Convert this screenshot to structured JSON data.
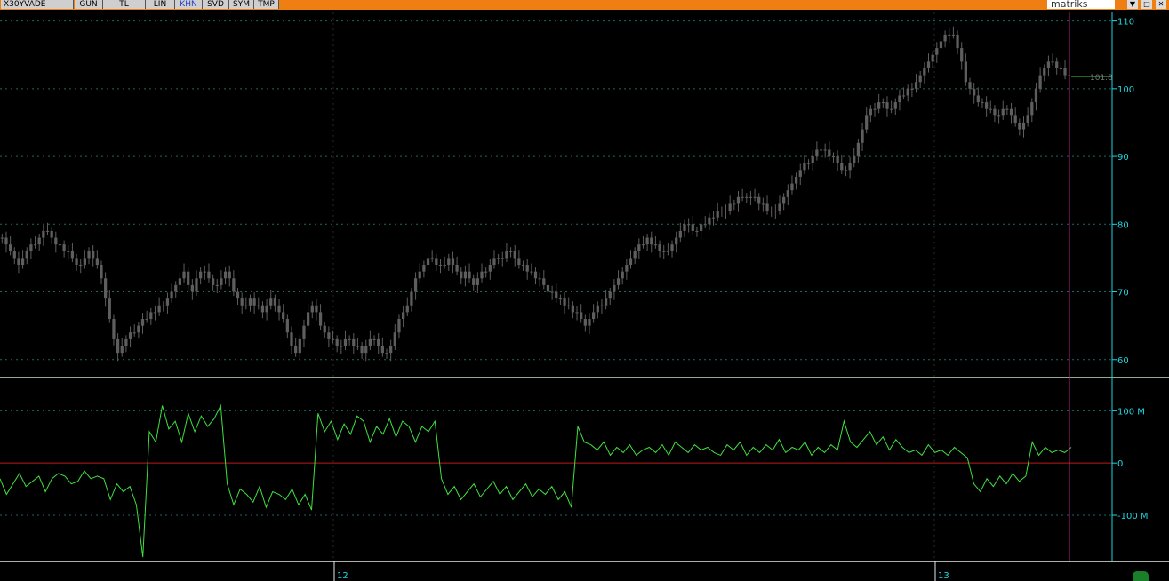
{
  "toolbar": {
    "symbol": "X30YVADE",
    "tabs": [
      {
        "label": "GUN",
        "active": false
      },
      {
        "label": "TL",
        "active": false
      },
      {
        "label": "LIN",
        "active": false
      },
      {
        "label": "KHN",
        "active": true
      },
      {
        "label": "SVD",
        "active": false
      },
      {
        "label": "SYM",
        "active": false
      },
      {
        "label": "TMP",
        "active": false
      }
    ],
    "brand": "matriks",
    "controls": [
      "▼",
      "□",
      "✕"
    ]
  },
  "colors": {
    "background": "#000000",
    "accent_bar": "#f07f13",
    "axis_text": "#1fd6e0",
    "candle": "#5e5e5e",
    "indicator_line": "#3fe13f",
    "zero_line": "#c01818",
    "cursor_line": "#b0208e",
    "last_price_line": "#2fa82f"
  },
  "chart_data": [
    {
      "type": "candlestick",
      "title": "",
      "last_price_label": "101.8",
      "y_ticks": [
        "110",
        "100",
        "90",
        "80",
        "70",
        "60"
      ],
      "ylim": [
        58,
        111
      ],
      "grid": true,
      "close_series": [
        78,
        77,
        76,
        75,
        74,
        75,
        76,
        77,
        77,
        78,
        79,
        79,
        78,
        77,
        77,
        76,
        76,
        75,
        74,
        74,
        75,
        76,
        75,
        74,
        72,
        69,
        66,
        63,
        61,
        62,
        63,
        64,
        64,
        65,
        66,
        66,
        67,
        67,
        68,
        68,
        69,
        70,
        71,
        72,
        73,
        71,
        70,
        72,
        73,
        73,
        72,
        71,
        71,
        72,
        73,
        72,
        70,
        69,
        68,
        68,
        69,
        68,
        68,
        67,
        68,
        69,
        68,
        67,
        66,
        64,
        62,
        61,
        63,
        65,
        67,
        68,
        67,
        65,
        64,
        63,
        63,
        62,
        62,
        63,
        63,
        62,
        62,
        61,
        62,
        63,
        63,
        62,
        61,
        61,
        62,
        64,
        66,
        67,
        68,
        70,
        72,
        73,
        74,
        75,
        75,
        74,
        74,
        74,
        75,
        74,
        73,
        72,
        73,
        72,
        71,
        72,
        73,
        73,
        74,
        75,
        75,
        75,
        76,
        76,
        75,
        74,
        74,
        73,
        73,
        72,
        72,
        71,
        70,
        70,
        69,
        69,
        68,
        68,
        67,
        67,
        66,
        65,
        66,
        67,
        68,
        68,
        69,
        70,
        71,
        72,
        73,
        74,
        75,
        76,
        77,
        77,
        78,
        77,
        77,
        76,
        76,
        76,
        77,
        78,
        79,
        80,
        80,
        79,
        79,
        80,
        80,
        81,
        81,
        82,
        82,
        82,
        83,
        83,
        84,
        84,
        84,
        84,
        84,
        83,
        83,
        82,
        82,
        82,
        83,
        84,
        85,
        86,
        87,
        88,
        89,
        89,
        90,
        91,
        91,
        91,
        90,
        90,
        89,
        88,
        88,
        89,
        90,
        92,
        94,
        96,
        97,
        97,
        98,
        98,
        97,
        97,
        98,
        99,
        99,
        100,
        100,
        101,
        102,
        103,
        104,
        105,
        106,
        107,
        108,
        108,
        108,
        106,
        104,
        101,
        100,
        99,
        98,
        98,
        97,
        97,
        96,
        96,
        97,
        97,
        96,
        95,
        94,
        95,
        96,
        98,
        100,
        102,
        103,
        104,
        104,
        103,
        103,
        102,
        102
      ]
    },
    {
      "type": "line",
      "title": "",
      "y_ticks": [
        "100 M",
        "0",
        "-100 M"
      ],
      "ylim": [
        -185,
        155
      ],
      "zero_line": true,
      "values": [
        -30,
        -60,
        -40,
        -20,
        -45,
        -35,
        -25,
        -55,
        -30,
        -20,
        -25,
        -40,
        -35,
        -15,
        -30,
        -25,
        -30,
        -70,
        -40,
        -55,
        -45,
        -80,
        -180,
        60,
        40,
        110,
        65,
        80,
        40,
        95,
        60,
        90,
        70,
        85,
        110,
        -40,
        -80,
        -50,
        -60,
        -75,
        -45,
        -85,
        -55,
        -60,
        -70,
        -50,
        -80,
        -60,
        -90,
        95,
        60,
        80,
        45,
        75,
        55,
        90,
        80,
        40,
        70,
        55,
        85,
        50,
        80,
        70,
        40,
        70,
        60,
        80,
        -30,
        -60,
        -45,
        -70,
        -55,
        -40,
        -65,
        -50,
        -35,
        -60,
        -45,
        -70,
        -55,
        -40,
        -65,
        -50,
        -60,
        -45,
        -70,
        -55,
        -85,
        70,
        40,
        35,
        25,
        40,
        15,
        30,
        20,
        35,
        15,
        25,
        30,
        20,
        35,
        15,
        40,
        30,
        20,
        35,
        25,
        30,
        20,
        15,
        35,
        25,
        40,
        15,
        30,
        20,
        35,
        25,
        45,
        20,
        30,
        25,
        40,
        15,
        30,
        20,
        35,
        25,
        80,
        40,
        30,
        45,
        60,
        35,
        50,
        25,
        45,
        30,
        20,
        25,
        15,
        35,
        20,
        25,
        15,
        30,
        20,
        10,
        -40,
        -55,
        -30,
        -45,
        -25,
        -40,
        -20,
        -35,
        -25,
        40,
        15,
        30,
        20,
        25,
        20,
        30
      ]
    }
  ],
  "x_axis": {
    "labels": [
      "12",
      "13"
    ]
  }
}
